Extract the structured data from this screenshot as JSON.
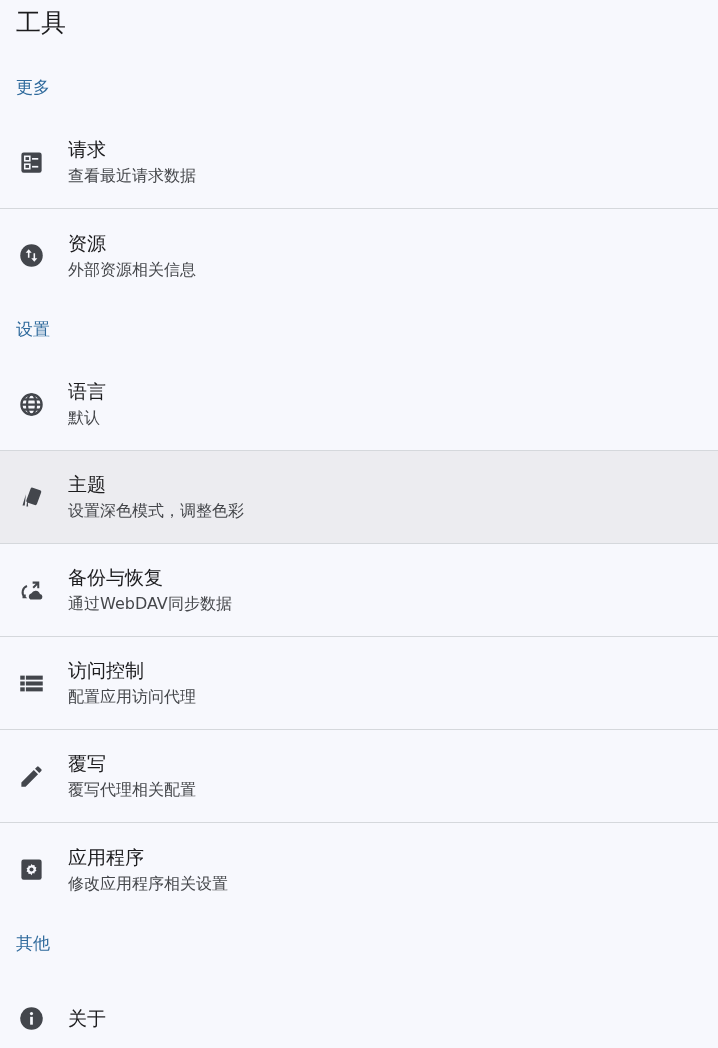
{
  "title": "工具",
  "sections": [
    {
      "header": "更多",
      "items": [
        {
          "title": "请求",
          "subtitle": "查看最近请求数据",
          "selected": false
        },
        {
          "title": "资源",
          "subtitle": "外部资源相关信息",
          "selected": false
        }
      ]
    },
    {
      "header": "设置",
      "items": [
        {
          "title": "语言",
          "subtitle": "默认",
          "selected": false
        },
        {
          "title": "主题",
          "subtitle": "设置深色模式，调整色彩",
          "selected": true
        },
        {
          "title": "备份与恢复",
          "subtitle": "通过WebDAV同步数据",
          "selected": false
        },
        {
          "title": "访问控制",
          "subtitle": "配置应用访问代理",
          "selected": false
        },
        {
          "title": "覆写",
          "subtitle": "覆写代理相关配置",
          "selected": false
        },
        {
          "title": "应用程序",
          "subtitle": "修改应用程序相关设置",
          "selected": false
        }
      ]
    },
    {
      "header": "其他",
      "items": [
        {
          "title": "关于",
          "selected": false
        }
      ]
    }
  ]
}
